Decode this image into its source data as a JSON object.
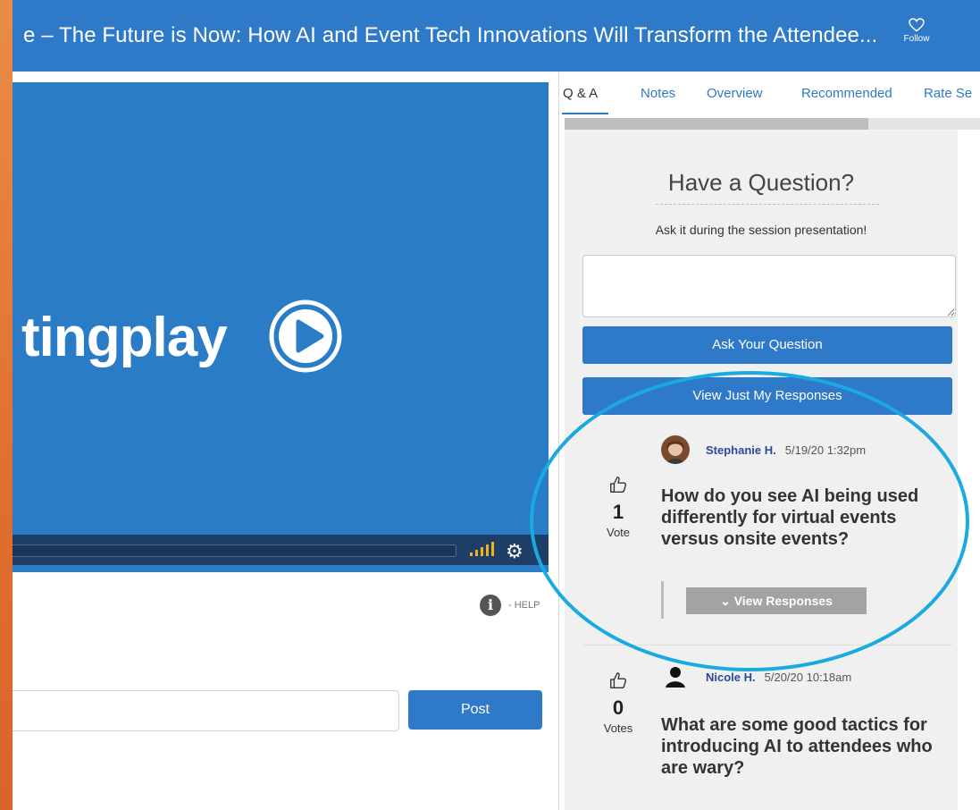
{
  "header": {
    "title": "e – The Future is Now: How AI and Event Tech Innovations Will Transform the Attendee...",
    "follow_label": "Follow"
  },
  "video": {
    "brand_text": "tingplay",
    "colors": {
      "background": "#2a7cc6",
      "controls": "#1d3e66"
    }
  },
  "help": {
    "label": "- HELP",
    "icon_glyph": "i"
  },
  "comment": {
    "value": "",
    "post_label": "Post"
  },
  "tabs": [
    {
      "label": "Q & A",
      "active": true
    },
    {
      "label": "Notes"
    },
    {
      "label": "Overview"
    },
    {
      "label": "Recommended"
    },
    {
      "label": "Rate Se"
    }
  ],
  "qa": {
    "heading": "Have a Question?",
    "subheading": "Ask it during the session presentation!",
    "question_value": "",
    "ask_button": "Ask Your Question",
    "my_responses_button": "View Just My Responses",
    "questions": [
      {
        "author": "Stephanie H.",
        "date": "5/19/20 1:32pm",
        "votes": "1",
        "vote_word": "Vote",
        "text": "How do you see AI being used differently for virtual events versus onsite events?",
        "responses_button": "View Responses"
      },
      {
        "author": "Nicole H.",
        "date": "5/20/20 10:18am",
        "votes": "0",
        "vote_word": "Votes",
        "text": "What are some good tactics for introducing AI to attendees who are wary?"
      }
    ]
  },
  "colors": {
    "accent": "#2f79c9",
    "highlight": "#1aa9e1",
    "background_orange": "#e57d3c"
  }
}
